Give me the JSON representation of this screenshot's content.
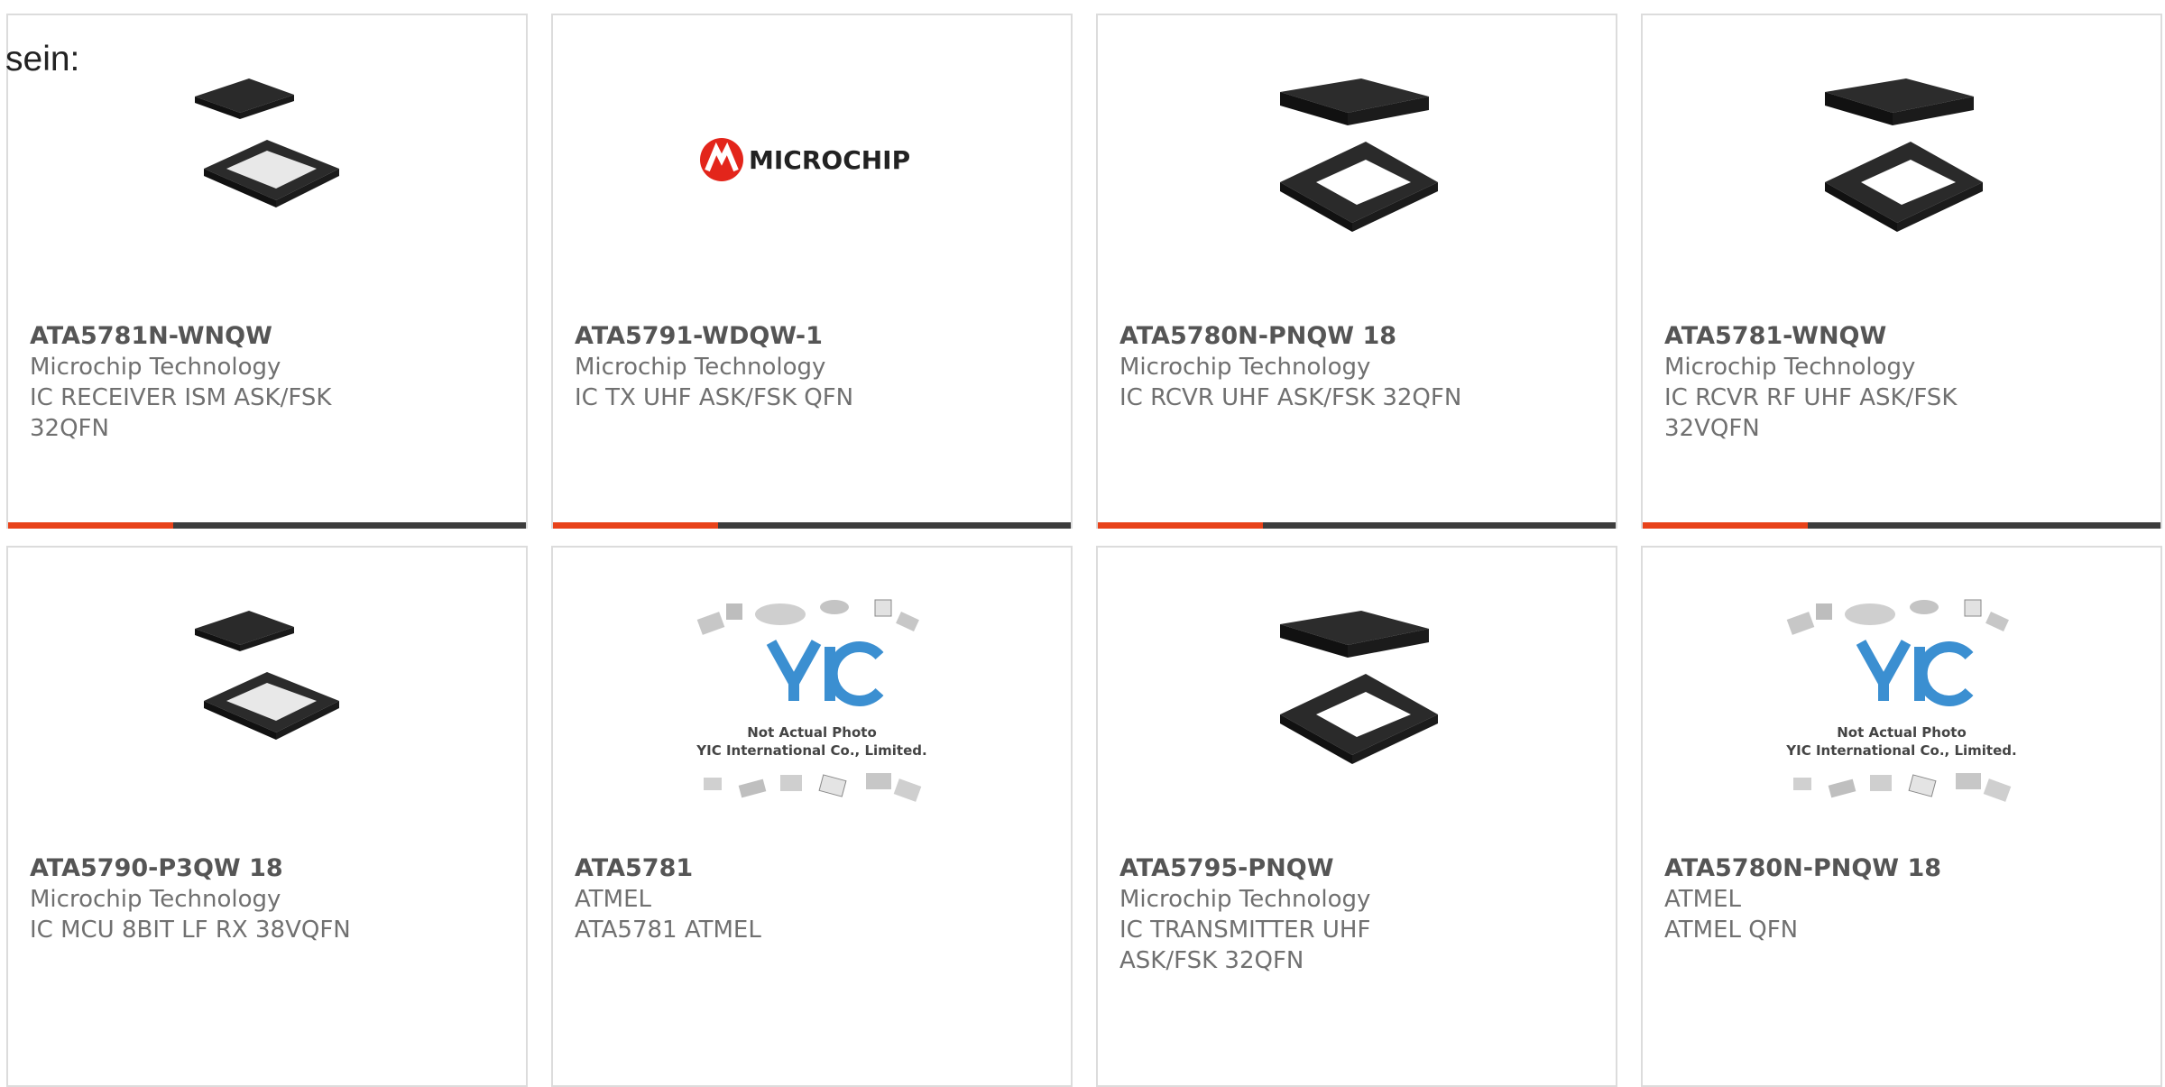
{
  "lead_text": "sein:",
  "accent_color": "#e8421a",
  "bar_color": "#3d3d3d",
  "products": [
    {
      "part": "ATA5781N-WNQW",
      "manufacturer": "Microchip Technology",
      "description": "IC RECEIVER ISM ASK/FSK 32QFN",
      "image": "qfn-chip-light"
    },
    {
      "part": "ATA5791-WDQW-1",
      "manufacturer": "Microchip Technology",
      "description": "IC TX UHF ASK/FSK QFN",
      "image": "microchip-logo",
      "logo_text": "MICROCHIP"
    },
    {
      "part": "ATA5780N-PNQW 18",
      "manufacturer": "Microchip Technology",
      "description": "IC RCVR UHF ASK/FSK 32QFN",
      "image": "qfn-chip-dark"
    },
    {
      "part": "ATA5781-WNQW",
      "manufacturer": "Microchip Technology",
      "description": "IC RCVR RF UHF ASK/FSK 32VQFN",
      "image": "qfn-chip-dark"
    },
    {
      "part": "ATA5790-P3QW 18",
      "manufacturer": "Microchip Technology",
      "description": "IC MCU 8BIT LF RX 38VQFN",
      "image": "qfn-chip-light"
    },
    {
      "part": "ATA5781",
      "manufacturer": "ATMEL",
      "description": "ATA5781 ATMEL",
      "image": "placeholder",
      "placeholder_line1": "Not Actual Photo",
      "placeholder_line2": "YIC International Co., Limited."
    },
    {
      "part": "ATA5795-PNQW",
      "manufacturer": "Microchip Technology",
      "description": "IC TRANSMITTER UHF ASK/FSK 32QFN",
      "image": "qfn-chip-dark"
    },
    {
      "part": "ATA5780N-PNQW 18",
      "manufacturer": "ATMEL",
      "description": "ATMEL QFN",
      "image": "placeholder",
      "placeholder_line1": "Not Actual Photo",
      "placeholder_line2": "YIC International Co., Limited."
    }
  ]
}
